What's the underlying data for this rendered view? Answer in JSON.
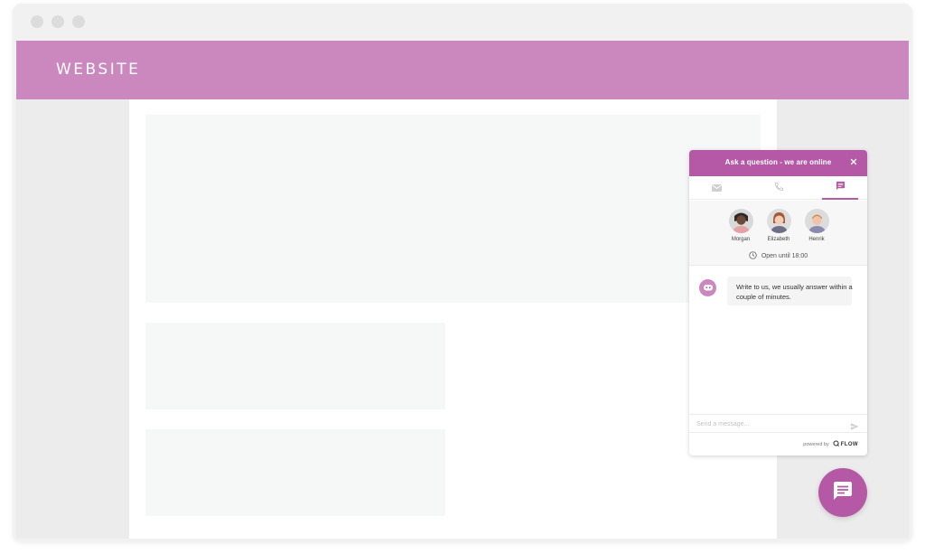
{
  "browser": {
    "controls": [
      "window-close-dot",
      "window-minimize-dot",
      "window-maximize-dot"
    ]
  },
  "site": {
    "title": "WEBSITE",
    "header_color": "#cb88bf"
  },
  "chat": {
    "header_title": "Ask a question - we are online",
    "accent_color": "#b558a5",
    "tabs": [
      {
        "icon": "envelope-icon",
        "active": false
      },
      {
        "icon": "phone-icon",
        "active": false
      },
      {
        "icon": "chat-icon",
        "active": true
      }
    ],
    "agents": [
      {
        "name": "Morgan"
      },
      {
        "name": "Elizabeth"
      },
      {
        "name": "Henrik"
      }
    ],
    "hours": "Open until 18:00",
    "message": "Write to us, we usually answer within a couple of minutes.",
    "input_placeholder": "Send a message...",
    "powered_by": "powered by",
    "brand": "FLOW"
  },
  "launcher": {
    "icon": "chat-bubble-icon"
  }
}
